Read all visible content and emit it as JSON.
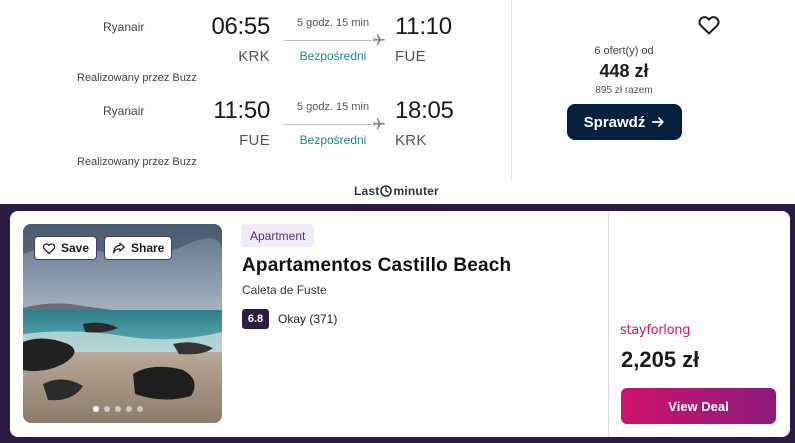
{
  "flight": {
    "legs": [
      {
        "airline": "Ryanair",
        "dep_time": "06:55",
        "dep_code": "KRK",
        "duration": "5 godz. 15 min",
        "stops": "Bezpośredni",
        "arr_time": "11:10",
        "arr_code": "FUE",
        "operated_by": "Realizowany przez Buzz"
      },
      {
        "airline": "Ryanair",
        "dep_time": "11:50",
        "dep_code": "FUE",
        "duration": "5 godz. 15 min",
        "stops": "Bezpośredni",
        "arr_time": "18:05",
        "arr_code": "KRK",
        "operated_by": "Realizowany przez Buzz"
      }
    ],
    "offers_label": "6 ofert(y) od",
    "price": "448 zł",
    "total": "895 zł razem",
    "cta_label": "Sprawdź",
    "provider_logo": {
      "part1": "Last",
      "part2": "minuter"
    }
  },
  "hotel": {
    "save_label": "Save",
    "share_label": "Share",
    "type": "Apartment",
    "name": "Apartamentos Castillo Beach",
    "location": "Caleta de Fuste",
    "rating": "6.8",
    "rating_text": "Okay (371)",
    "provider": "stayforlong",
    "price": "2,205 zł",
    "cta_label": "View Deal",
    "photo_count": 5,
    "active_photo": 1
  },
  "colors": {
    "primary_button": "#05203c",
    "direct_text": "#1a8a8a",
    "hotel_bg": "#2d1a45",
    "provider_pink": "#d6126d",
    "deal_gradient_start": "#d0126b",
    "deal_gradient_end": "#8c1a7d"
  },
  "icons": [
    "plane-icon",
    "heart-icon",
    "arrow-right-icon",
    "share-icon",
    "clock-icon"
  ]
}
